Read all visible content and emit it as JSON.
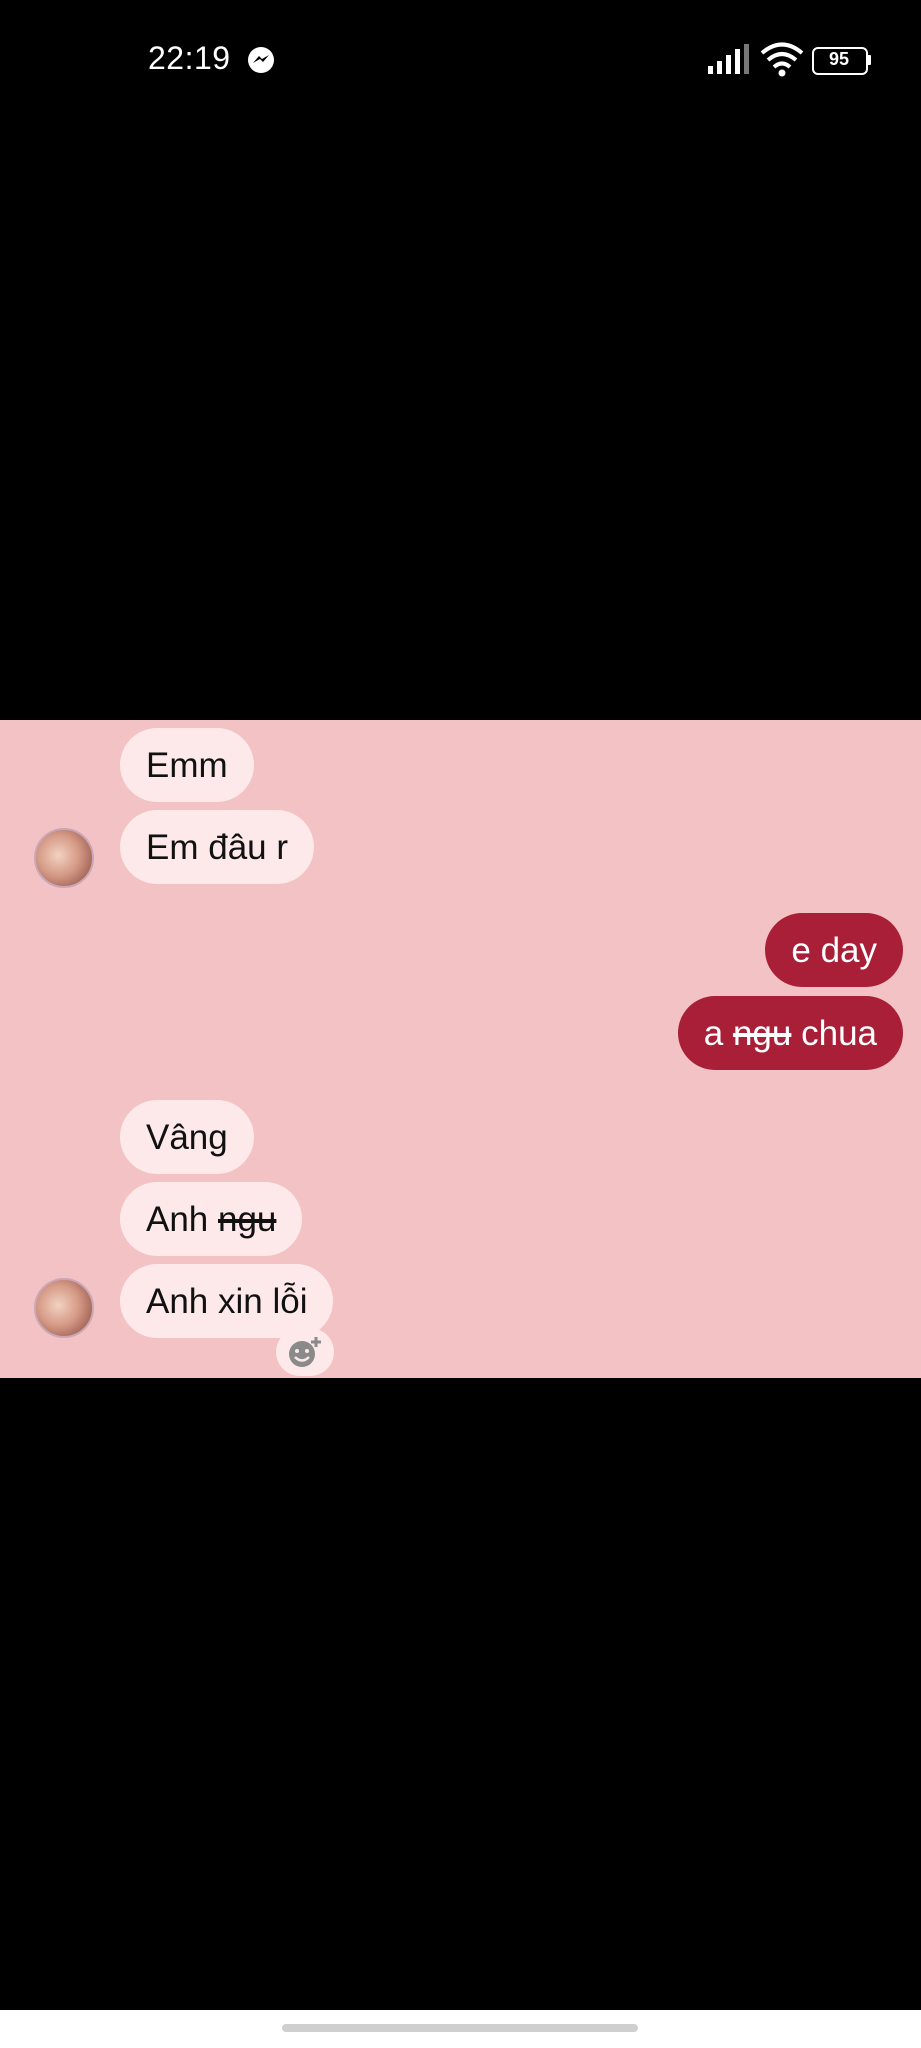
{
  "status_bar": {
    "time": "22:19",
    "battery": "95",
    "icons": [
      "messenger-icon",
      "signal-icon",
      "wifi-icon",
      "battery-icon"
    ]
  },
  "chat": {
    "background_color": "#f3c2c4",
    "incoming_bubble_color": "#fde9ea",
    "outgoing_bubble_color": "#a91f38",
    "messages": [
      {
        "sender": "them",
        "text": "Emm"
      },
      {
        "sender": "them",
        "text": "Em đâu r"
      },
      {
        "sender": "me",
        "text": "e day"
      },
      {
        "sender": "me",
        "parts": [
          "a ",
          "ngu",
          " chua"
        ],
        "struck_part": "ngu"
      },
      {
        "sender": "them",
        "text": "Vâng"
      },
      {
        "sender": "them",
        "parts": [
          "Anh ",
          "ngu"
        ],
        "struck_part": "ngu"
      },
      {
        "sender": "them",
        "text": "Anh xin lỗi"
      }
    ]
  }
}
